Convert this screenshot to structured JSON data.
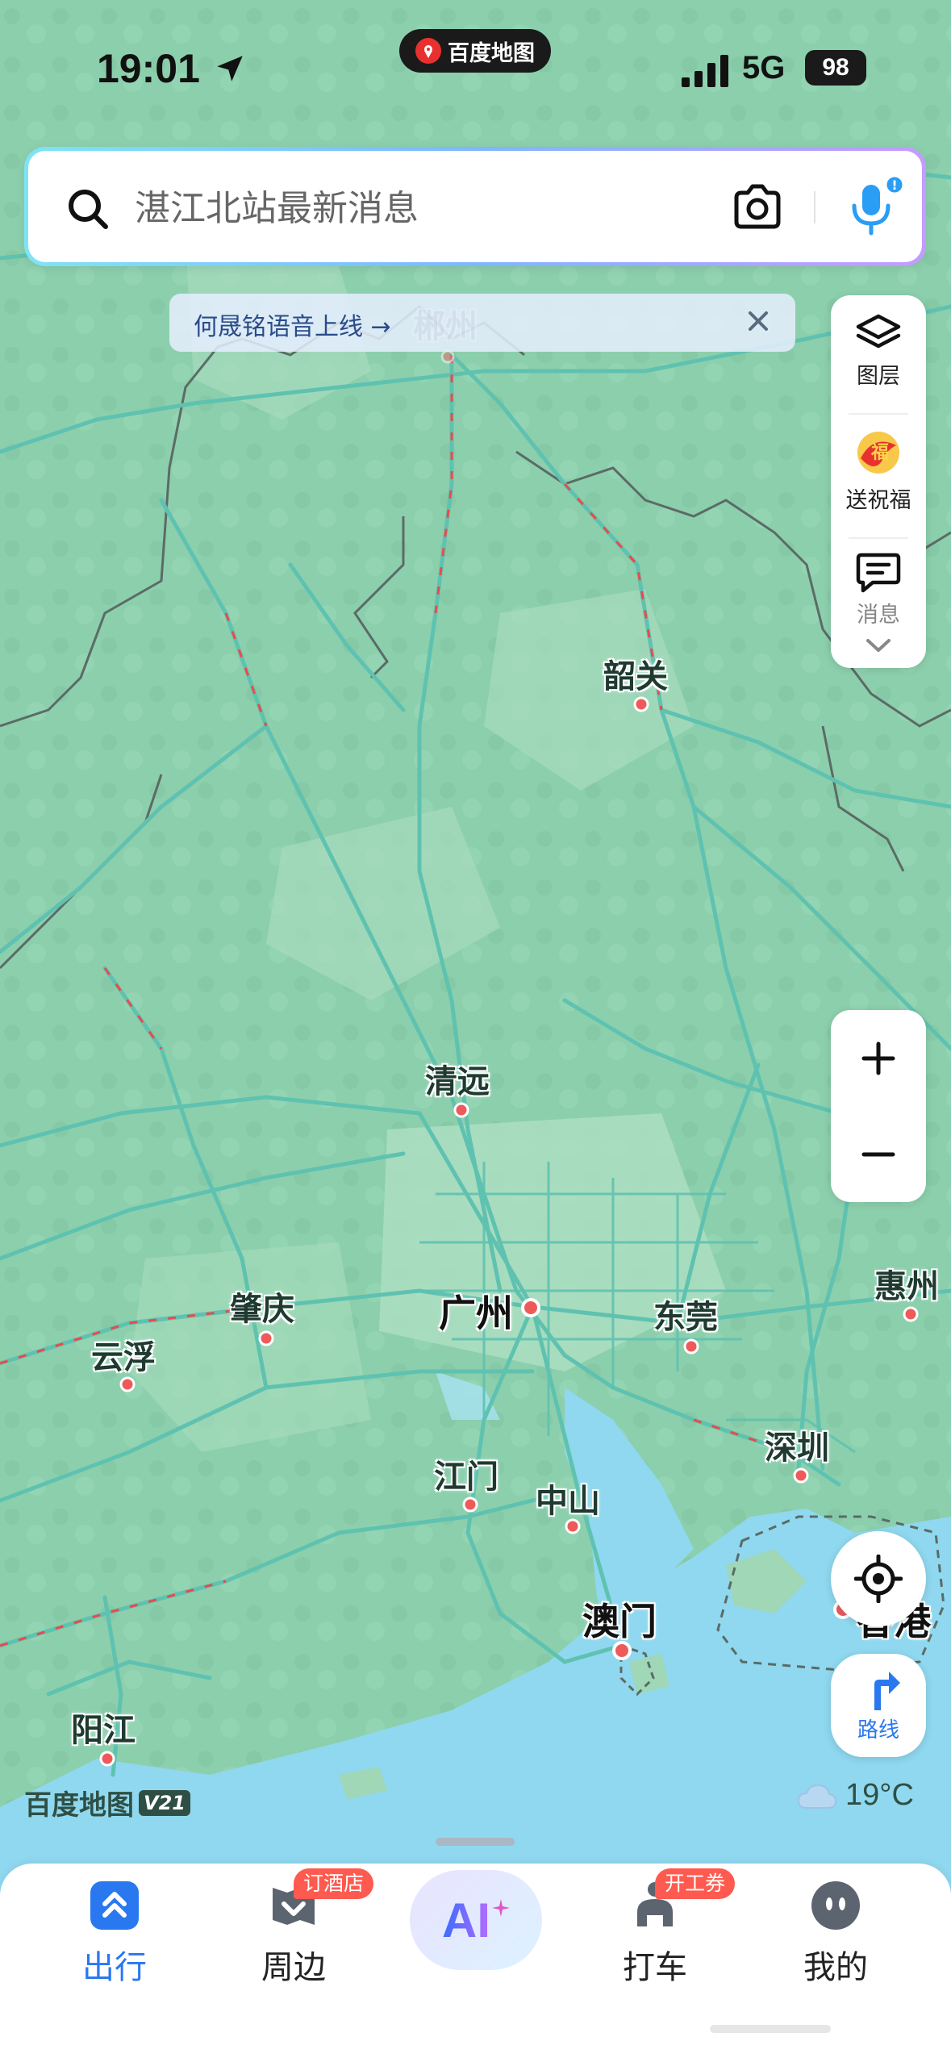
{
  "status_bar": {
    "time": "19:01",
    "app_brand": "百度地图",
    "network": "5G",
    "battery": "98"
  },
  "search": {
    "placeholder": "湛江北站最新消息"
  },
  "notice": {
    "text": "何晟铭语音上线 →"
  },
  "toolbar": {
    "layers_label": "图层",
    "blessing_label": "送祝福",
    "messages_label": "消息"
  },
  "route": {
    "label": "路线"
  },
  "map": {
    "attribution": "百度地图",
    "version": "V21",
    "cities": [
      {
        "name": "郴州",
        "faded": true
      },
      {
        "name": "韶关"
      },
      {
        "name": "清远"
      },
      {
        "name": "广州",
        "major": true
      },
      {
        "name": "东莞"
      },
      {
        "name": "惠州"
      },
      {
        "name": "肇庆"
      },
      {
        "name": "云浮"
      },
      {
        "name": "江门"
      },
      {
        "name": "中山"
      },
      {
        "name": "深圳"
      },
      {
        "name": "澳门",
        "major": true
      },
      {
        "name": "香港",
        "major": true
      },
      {
        "name": "阳江"
      }
    ]
  },
  "weather": {
    "temperature": "19°C",
    "icon": "cloud-icon"
  },
  "bottom_nav": {
    "tabs": [
      {
        "label": "出行",
        "active": true,
        "icon": "travel-icon"
      },
      {
        "label": "周边",
        "badge": "订酒店",
        "icon": "nearby-icon"
      },
      {
        "label": "AI",
        "icon": "ai-icon"
      },
      {
        "label": "打车",
        "badge": "开工券",
        "icon": "taxi-icon"
      },
      {
        "label": "我的",
        "icon": "profile-icon"
      }
    ]
  },
  "colors": {
    "accent": "#2a78f0",
    "badge": "#ff5a4f",
    "land": "#8fd0ae",
    "road": "#5fc2b0",
    "sea": "#8fd8ef"
  }
}
